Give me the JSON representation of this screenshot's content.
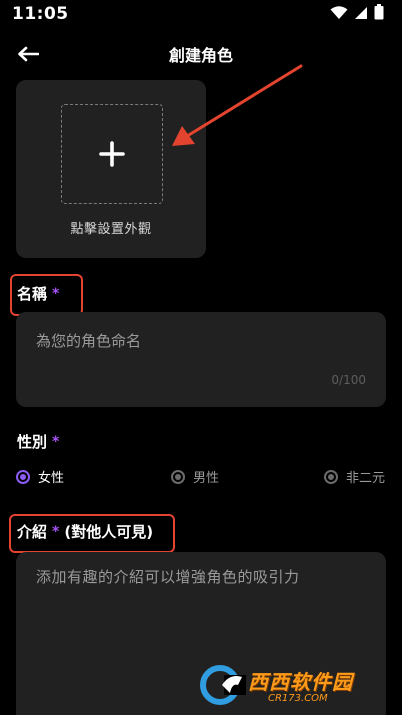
{
  "status_bar": {
    "time": "11:05",
    "icons": [
      "wifi-icon",
      "signal-icon",
      "battery-icon"
    ]
  },
  "header": {
    "back_icon": "back-arrow-icon",
    "title": "創建角色"
  },
  "avatar": {
    "add_icon": "plus-icon",
    "caption": "點擊設置外觀"
  },
  "name_field": {
    "label": "名稱",
    "required_mark": "*",
    "placeholder": "為您的角色命名",
    "counter": "0/100"
  },
  "gender_field": {
    "label": "性別",
    "required_mark": "*",
    "options": [
      {
        "label": "女性",
        "selected": true
      },
      {
        "label": "男性",
        "selected": false
      },
      {
        "label": "非二元",
        "selected": false
      }
    ]
  },
  "intro_field": {
    "label": "介紹",
    "required_mark": "*",
    "note": "(對他人可見)",
    "placeholder": "添加有趣的介紹可以增強角色的吸引力"
  },
  "watermark": {
    "logo": "cr-logo-icon",
    "main": "西西软件园",
    "url": "CR173.COM"
  },
  "colors": {
    "background": "#000000",
    "card": "#212121",
    "accent": "#8b5cf6",
    "required": "#a855f7",
    "annotation": "#e2442f"
  }
}
